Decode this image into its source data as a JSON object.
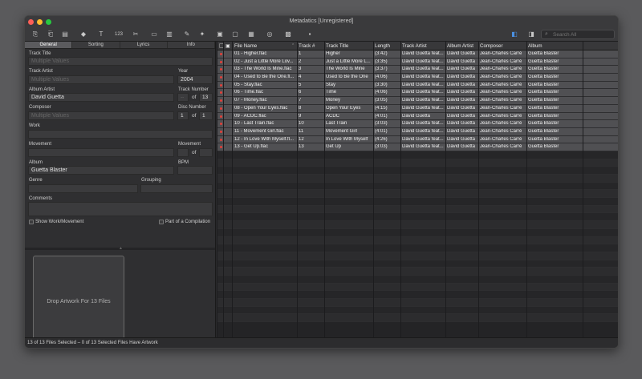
{
  "app": {
    "title": "Metadatics [Unregistered]"
  },
  "toolbar": {
    "icons": [
      "doc-import-icon",
      "doc-export-icon",
      "doc-icon",
      "tag-icon",
      "text-icon",
      "numbers-icon",
      "tools-icon",
      "barcode-icon",
      "book-icon",
      "rename-icon",
      "magic-icon",
      "artwork-icon",
      "artwork-remove-icon",
      "artwork-export-icon",
      "globe-icon",
      "image-icon",
      "save-icon",
      "sidebar-left-icon",
      "sidebar-right-icon"
    ],
    "search_placeholder": "Search All"
  },
  "editor": {
    "tabs": [
      "General",
      "Sorting",
      "Lyrics",
      "Info"
    ],
    "selected_tab": "General",
    "fields": {
      "track_title": {
        "label": "Track Title",
        "value": "Multiple Values"
      },
      "track_artist": {
        "label": "Track Artist",
        "value": "Multiple Values"
      },
      "year": {
        "label": "Year",
        "value": "2004"
      },
      "album_artist": {
        "label": "Album Artist",
        "value": "David Guetta"
      },
      "track_number": {
        "label": "Track Number",
        "value": "--",
        "of": "of",
        "total": "13"
      },
      "composer": {
        "label": "Composer",
        "value": "Multiple Values"
      },
      "disc_number": {
        "label": "Disc Number",
        "value": "1",
        "of": "of",
        "total": "1"
      },
      "work": {
        "label": "Work",
        "value": ""
      },
      "movement": {
        "label": "Movement",
        "value": ""
      },
      "movement_number": {
        "label": "Movement",
        "value": "",
        "of": "of",
        "total": ""
      },
      "album": {
        "label": "Album",
        "value": "Guetta Blaster"
      },
      "bpm": {
        "label": "BPM",
        "value": ""
      },
      "genre": {
        "label": "Genre",
        "value": ""
      },
      "grouping": {
        "label": "Grouping",
        "value": ""
      },
      "comments": {
        "label": "Comments",
        "value": ""
      }
    },
    "show_work_label": "Show Work/Movement",
    "compilation_label": "Part of a Compilation",
    "artwork_drop": "Drop Artwork For 13 Files"
  },
  "table": {
    "columns": [
      "File Name",
      "Track #",
      "Track Title",
      "Length",
      "Track Artist",
      "Album Artist",
      "Composer",
      "Album"
    ],
    "rows": [
      [
        "01 - Higher.flac",
        "1",
        "Higher",
        "(3:42)",
        "David Guetta feat...",
        "David Guetta",
        "Jean-Charles Carré",
        "Guetta Blaster"
      ],
      [
        "02 - Just a Little More Lov...",
        "2",
        "Just a Little More L...",
        "(3:35)",
        "David Guetta feat...",
        "David Guetta",
        "Jean-Charles Carré",
        "Guetta Blaster"
      ],
      [
        "03 - The World Is Mine.flac",
        "3",
        "The World Is Mine",
        "(3:37)",
        "David Guetta feat...",
        "David Guetta",
        "Jean-Charles Carré",
        "Guetta Blaster"
      ],
      [
        "04 - Used to Be the One.fl...",
        "4",
        "Used to Be the One",
        "(4:06)",
        "David Guetta feat...",
        "David Guetta",
        "Jean-Charles Carré",
        "Guetta Blaster"
      ],
      [
        "05 - Stay.flac",
        "5",
        "Stay",
        "(3:30)",
        "David Guetta feat...",
        "David Guetta",
        "Jean-Charles Carré",
        "Guetta Blaster"
      ],
      [
        "06 - Time.flac",
        "6",
        "Time",
        "(4:06)",
        "David Guetta feat...",
        "David Guetta",
        "Jean-Charles Carré",
        "Guetta Blaster"
      ],
      [
        "07 - Money.flac",
        "7",
        "Money",
        "(3:05)",
        "David Guetta feat...",
        "David Guetta",
        "Jean-Charles Carré",
        "Guetta Blaster"
      ],
      [
        "08 - Open Your Eyes.flac",
        "8",
        "Open Your Eyes",
        "(4:15)",
        "David Guetta feat...",
        "David Guetta",
        "Jean-Charles Carré",
        "Guetta Blaster"
      ],
      [
        "09 - ACDC.flac",
        "9",
        "ACDC",
        "(4:01)",
        "David Guetta",
        "David Guetta",
        "Jean-Charles Carré",
        "Guetta Blaster"
      ],
      [
        "10 - Last Train.flac",
        "10",
        "Last Train",
        "(3:03)",
        "David Guetta feat...",
        "David Guetta",
        "Jean-Charles Carré",
        "Guetta Blaster"
      ],
      [
        "11 - Movement Girl.flac",
        "11",
        "Movement Girl",
        "(4:01)",
        "David Guetta feat...",
        "David Guetta",
        "Jean-Charles Carré",
        "Guetta Blaster"
      ],
      [
        "12 - In Love With Myself.fl...",
        "12",
        "In Love With Myself",
        "(4:26)",
        "David Guetta feat...",
        "David Guetta",
        "Jean-Charles Carré",
        "Guetta Blaster"
      ],
      [
        "13 - Get Up.flac",
        "13",
        "Get Up",
        "(3:03)",
        "David Guetta feat...",
        "David Guetta",
        "Jean-Charles Carré",
        "Guetta Blaster"
      ]
    ]
  },
  "status": "13 of 13 Files Selected – 0 of 13 Selected Files Have Artwork"
}
